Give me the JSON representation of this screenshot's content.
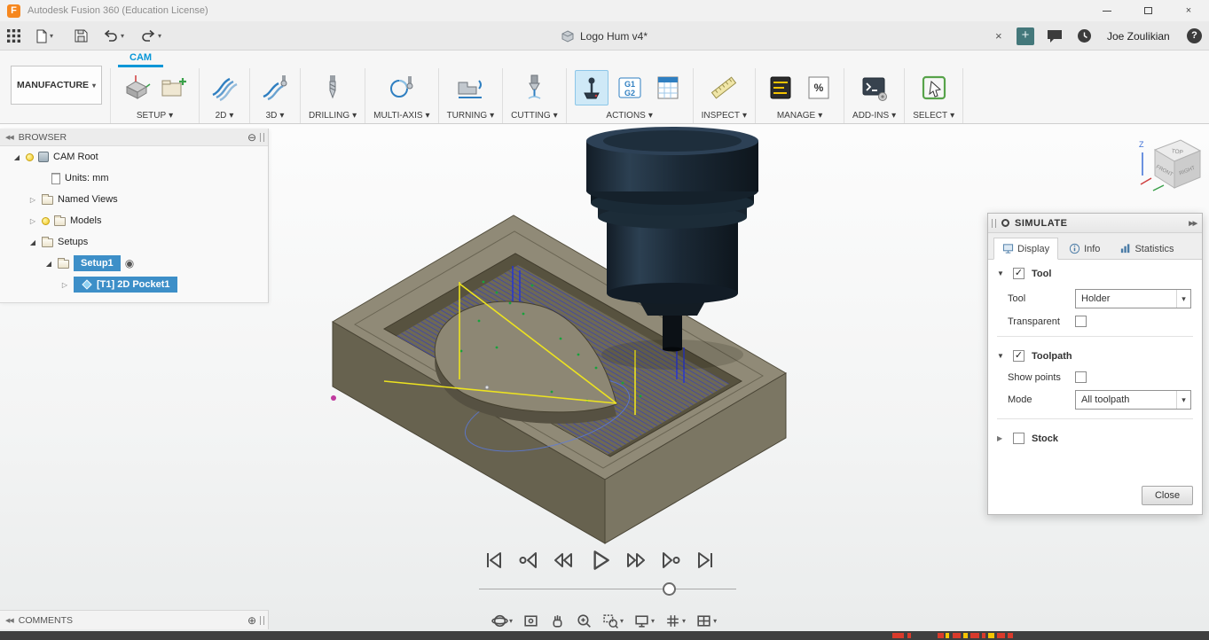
{
  "colors": {
    "accent_blue": "#0696d7",
    "selection_blue": "#3d8fc8",
    "active_tool_highlight": "#cfe9f7",
    "toolpath_blue": "#2433d6",
    "rapid_yellow": "#ede31f",
    "status_red": "#d93a2b",
    "status_yellow": "#f5c400"
  },
  "icons": {
    "dropdown": "▾",
    "close": "×",
    "plus": "+",
    "help": "?",
    "collapse_left": "◀◀",
    "expand_right": "▶▶",
    "circle_minus": "⊖",
    "circle_plus": "⊕",
    "active_setup_radio": "◉",
    "expanded_arrow": "◢",
    "collapsed_arrow": "▷",
    "section_expanded": "▼",
    "section_collapsed": "▶",
    "check": "✓"
  },
  "title_bar": {
    "app_title": "Autodesk Fusion 360 (Education License)"
  },
  "qat": {
    "document_tab": "Logo Hum v4*",
    "user_name": "Joe Zoulikian"
  },
  "ribbon": {
    "workspace_button": "MANUFACTURE",
    "active_tab": "CAM",
    "groups": [
      {
        "label": "SETUP"
      },
      {
        "label": "2D"
      },
      {
        "label": "3D"
      },
      {
        "label": "DRILLING"
      },
      {
        "label": "MULTI-AXIS"
      },
      {
        "label": "TURNING"
      },
      {
        "label": "CUTTING"
      },
      {
        "label": "ACTIONS"
      },
      {
        "label": "INSPECT"
      },
      {
        "label": "MANAGE"
      },
      {
        "label": "ADD-INS"
      },
      {
        "label": "SELECT"
      }
    ],
    "post_icon_lines": [
      "G1",
      "G2"
    ],
    "manage_percent": "%"
  },
  "browser": {
    "header": "BROWSER",
    "items": [
      {
        "label": "CAM Root"
      },
      {
        "label": "Units: mm"
      },
      {
        "label": "Named Views"
      },
      {
        "label": "Models"
      },
      {
        "label": "Setups"
      },
      {
        "label": "Setup1"
      },
      {
        "label": "[T1] 2D Pocket1"
      }
    ]
  },
  "comments": {
    "header": "COMMENTS"
  },
  "viewcube": {
    "top": "TOP",
    "front": "FRONT",
    "right": "RIGHT",
    "axis_z": "Z"
  },
  "simulate": {
    "title": "SIMULATE",
    "tabs": [
      {
        "label": "Display"
      },
      {
        "label": "Info"
      },
      {
        "label": "Statistics"
      }
    ],
    "active_tab": "Display",
    "tool_section": {
      "label": "Tool",
      "enabled": true,
      "tool_label": "Tool",
      "tool_value": "Holder",
      "transparent_label": "Transparent",
      "transparent_checked": false
    },
    "toolpath_section": {
      "label": "Toolpath",
      "enabled": true,
      "show_points_label": "Show points",
      "show_points_checked": false,
      "mode_label": "Mode",
      "mode_value": "All toolpath"
    },
    "stock_section": {
      "label": "Stock",
      "enabled": false
    },
    "close_button": "Close"
  },
  "playback": {
    "buttons": [
      "go-to-beginning",
      "previous-operation",
      "play-backward",
      "play",
      "fast-forward",
      "next-operation",
      "go-to-end"
    ],
    "slider_position_pct": 74
  }
}
